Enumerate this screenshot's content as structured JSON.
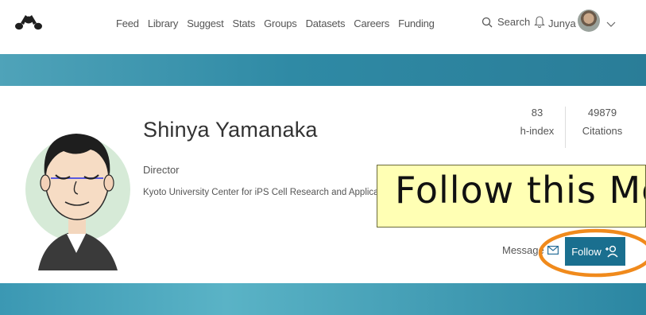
{
  "nav": {
    "links": [
      "Feed",
      "Library",
      "Suggest",
      "Stats",
      "Groups",
      "Datasets",
      "Careers",
      "Funding"
    ],
    "search_label": "Search",
    "user_name": "Junya"
  },
  "profile": {
    "name": "Shinya Yamanaka",
    "role": "Director",
    "organization": "Kyoto University Center for iPS Cell Research and Application",
    "stats": [
      {
        "value": "83",
        "label": "h-index"
      },
      {
        "value": "49879",
        "label": "Citations"
      }
    ],
    "message_label": "Message",
    "follow_label": "Follow"
  },
  "overlay": {
    "tooltip_text": "Follow this Member",
    "highlight_color": "#f08a1c",
    "tooltip_bg": "#ffffb4"
  },
  "colors": {
    "banner": "#2f8aa5",
    "follow_button": "#1a6f8f"
  }
}
